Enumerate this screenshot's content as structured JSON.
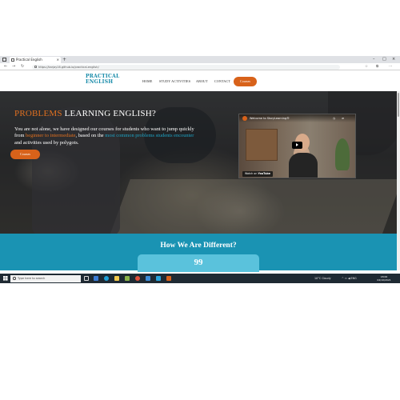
{
  "browser": {
    "tab_title": "Practical English",
    "tab_close": "×",
    "new_tab": "+",
    "window_controls": [
      "–",
      "□",
      "×"
    ],
    "url": "https://karjay16.github.io/practical-english/",
    "nav": {
      "back": "←",
      "forward": "→",
      "reload": "↻"
    },
    "toolbar_icons": [
      "☆",
      "⧉",
      "⋯"
    ]
  },
  "site": {
    "logo_line1": "PRACTICAL",
    "logo_line2": "ENGLISH",
    "nav": [
      "HOME",
      "STUDY ACTIVITIES",
      "ABOUT",
      "CONTACT"
    ],
    "cta": "Courses"
  },
  "hero": {
    "title_accent": "PROBLEMS",
    "title_rest": " LEARNING ENGLISH?",
    "text_1": "You are not alone, we have designed our courses for students who want to jump quickly from ",
    "text_orange": "beginner to intermediate",
    "text_2": ", based on the ",
    "text_teal": "most common problems students encounter",
    "text_3": " and activities used by polygots.",
    "button": "Courses",
    "video": {
      "title": "Welcome to StoryLearning®",
      "watch_on": "Watch on",
      "platform": "YouTube",
      "icons": [
        "◷",
        "➦"
      ]
    }
  },
  "section": {
    "title": "How We Are Different?",
    "quote_icon": "99"
  },
  "taskbar": {
    "search_placeholder": "Type here to search",
    "weather": "10°C Cloudy",
    "tray_icons": "^ ▭ ◀ ENG",
    "time": "18:00",
    "date": "04/10/2021"
  }
}
